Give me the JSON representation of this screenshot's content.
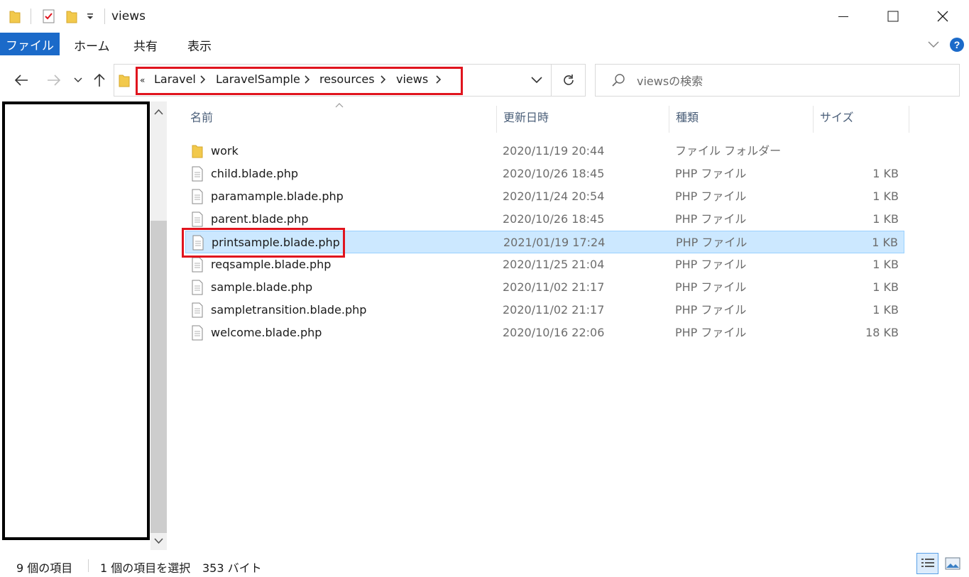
{
  "window": {
    "title": "views"
  },
  "ribbon": {
    "tabs": [
      "ファイル",
      "ホーム",
      "共有",
      "表示"
    ]
  },
  "address": {
    "overflow": "«",
    "crumbs": [
      "Laravel",
      "LaravelSample",
      "resources",
      "views"
    ]
  },
  "search": {
    "placeholder": "viewsの検索"
  },
  "columns": {
    "name": "名前",
    "modified": "更新日時",
    "type": "種類",
    "size": "サイズ"
  },
  "files": [
    {
      "name": "work",
      "modified": "2020/11/19 20:44",
      "type": "ファイル フォルダー",
      "size": "",
      "icon": "folder-icon"
    },
    {
      "name": "child.blade.php",
      "modified": "2020/10/26 18:45",
      "type": "PHP ファイル",
      "size": "1 KB",
      "icon": "file-icon"
    },
    {
      "name": "paramample.blade.php",
      "modified": "2020/11/24 20:54",
      "type": "PHP ファイル",
      "size": "1 KB",
      "icon": "file-icon"
    },
    {
      "name": "parent.blade.php",
      "modified": "2020/10/26 18:45",
      "type": "PHP ファイル",
      "size": "1 KB",
      "icon": "file-icon"
    },
    {
      "name": "printsample.blade.php",
      "modified": "2021/01/19 17:24",
      "type": "PHP ファイル",
      "size": "1 KB",
      "icon": "file-icon",
      "selected": true
    },
    {
      "name": "reqsample.blade.php",
      "modified": "2020/11/25 21:04",
      "type": "PHP ファイル",
      "size": "1 KB",
      "icon": "file-icon"
    },
    {
      "name": "sample.blade.php",
      "modified": "2020/11/02 21:17",
      "type": "PHP ファイル",
      "size": "1 KB",
      "icon": "file-icon"
    },
    {
      "name": "sampletransition.blade.php",
      "modified": "2020/11/02 21:17",
      "type": "PHP ファイル",
      "size": "1 KB",
      "icon": "file-icon"
    },
    {
      "name": "welcome.blade.php",
      "modified": "2020/10/16 22:06",
      "type": "PHP ファイル",
      "size": "18 KB",
      "icon": "file-icon"
    }
  ],
  "status": {
    "item_count": "9 個の項目",
    "selection": "1 個の項目を選択",
    "selection_size": "353 バイト"
  },
  "colors": {
    "accent": "#1b6ac9",
    "selection_bg": "#cce8ff",
    "highlight_red": "#e0141e",
    "folder": "#f2c94c"
  }
}
